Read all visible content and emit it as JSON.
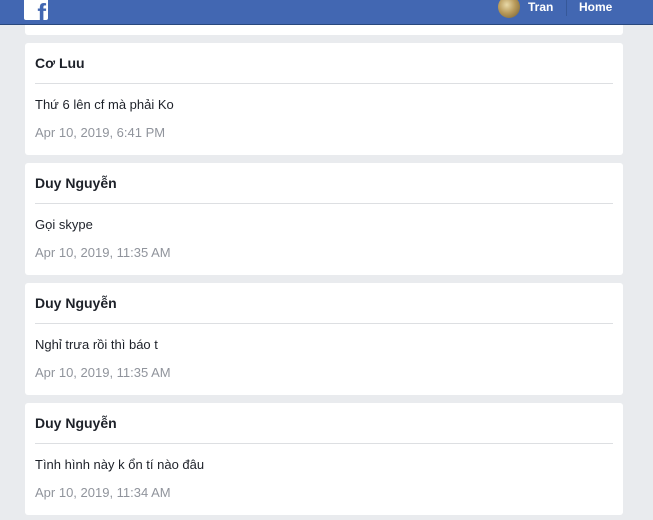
{
  "header": {
    "user_name": "Tran",
    "home_label": "Home",
    "brand_color": "#4267b2"
  },
  "messages": [
    {
      "author": "Cơ Luu",
      "text": "Thứ 6 lên cf mà phải Ko",
      "time": "Apr 10, 2019, 6:41 PM"
    },
    {
      "author": "Duy Nguyễn",
      "text": "Gọi skype",
      "time": "Apr 10, 2019, 11:35 AM"
    },
    {
      "author": "Duy Nguyễn",
      "text": "Nghỉ trưa rồi thì báo t",
      "time": "Apr 10, 2019, 11:35 AM"
    },
    {
      "author": "Duy Nguyễn",
      "text": "Tình hình này k ổn tí nào đâu",
      "time": "Apr 10, 2019, 11:34 AM"
    }
  ]
}
